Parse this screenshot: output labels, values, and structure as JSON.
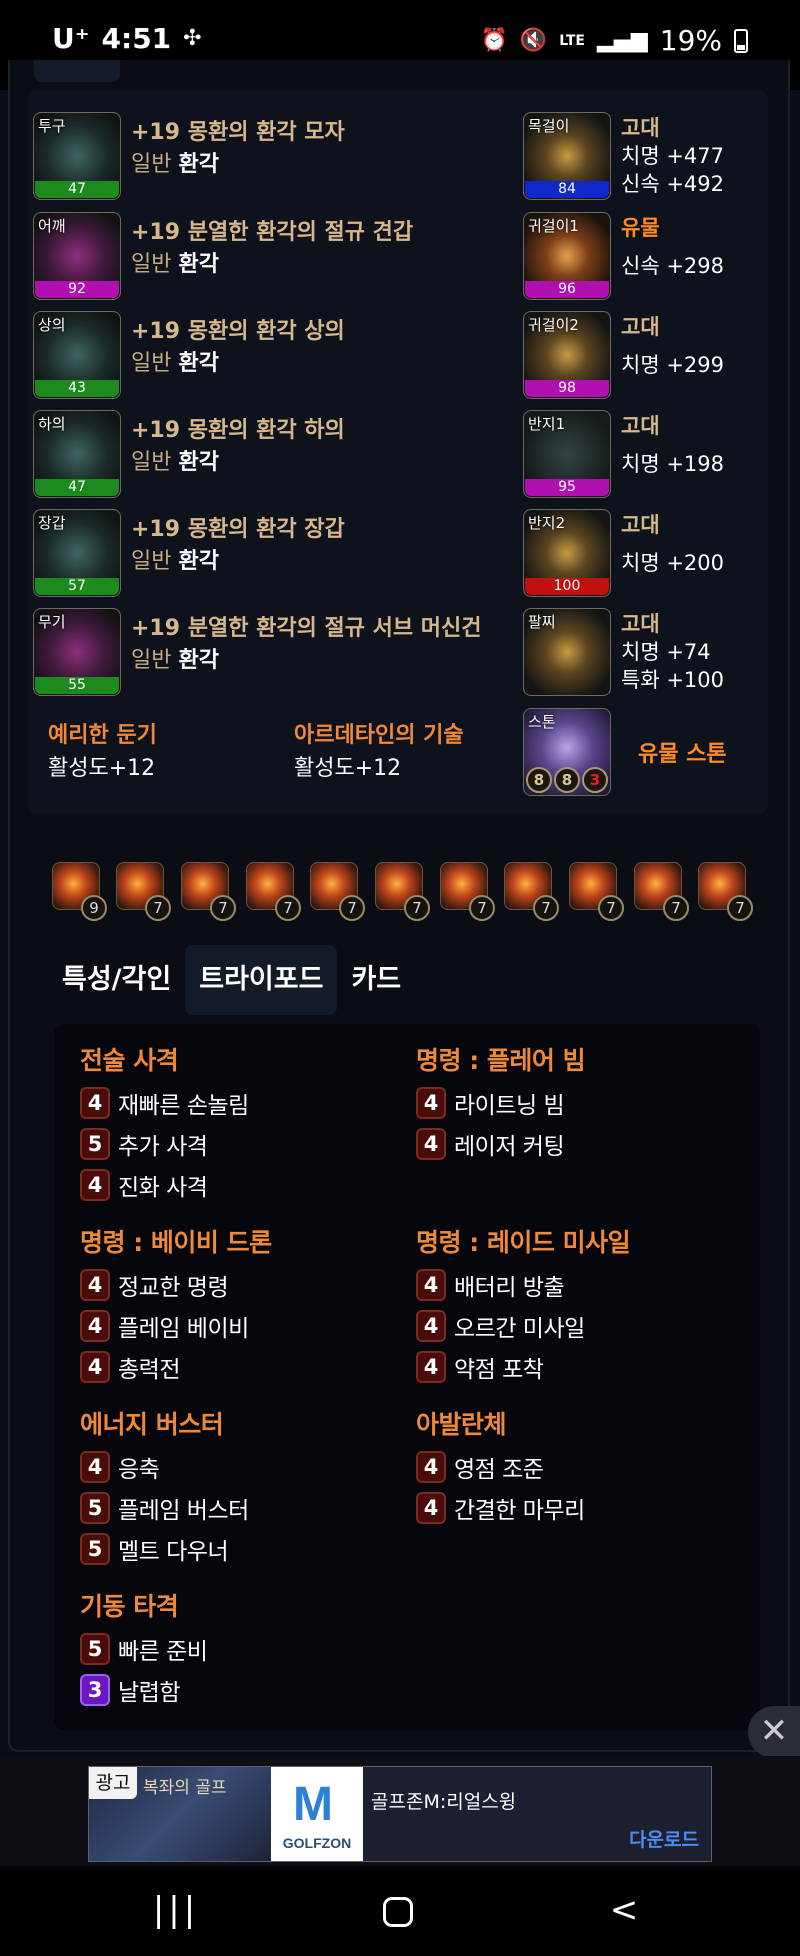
{
  "status_bar": {
    "carrier": "U⁺",
    "time": "4:51",
    "network": "LTE",
    "battery": "19%"
  },
  "equipment": [
    {
      "slot": "투구",
      "quality": 47,
      "quality_color": "#1d8a1d",
      "name": "+19 몽환의 환각 모자",
      "sub_a": "일반",
      "sub_b": "환각",
      "icon": "helmet-icon"
    },
    {
      "slot": "어깨",
      "quality": 92,
      "quality_color": "#b010b0",
      "name": "+19 분열한 환각의 절규 견갑",
      "sub_a": "일반",
      "sub_b": "환각",
      "icon": "shoulder-icon"
    },
    {
      "slot": "상의",
      "quality": 43,
      "quality_color": "#1d8a1d",
      "name": "+19 몽환의 환각 상의",
      "sub_a": "일반",
      "sub_b": "환각",
      "icon": "chest-icon"
    },
    {
      "slot": "하의",
      "quality": 47,
      "quality_color": "#1d8a1d",
      "name": "+19 몽환의 환각 하의",
      "sub_a": "일반",
      "sub_b": "환각",
      "icon": "pants-icon"
    },
    {
      "slot": "장갑",
      "quality": 57,
      "quality_color": "#1d8a1d",
      "name": "+19 몽환의 환각 장갑",
      "sub_a": "일반",
      "sub_b": "환각",
      "icon": "gloves-icon"
    },
    {
      "slot": "무기",
      "quality": 55,
      "quality_color": "#1d8a1d",
      "name": "+19 분열한 환각의 절규 서브 머신건",
      "sub_a": "일반",
      "sub_b": "환각",
      "icon": "weapon-icon"
    }
  ],
  "accessories": [
    {
      "slot": "목걸이",
      "quality": 84,
      "quality_color": "#1028c8",
      "grade": "고대",
      "stats": [
        "치명 +477",
        "신속 +492"
      ],
      "icon": "necklace-icon"
    },
    {
      "slot": "귀걸이1",
      "quality": 96,
      "quality_color": "#b010b0",
      "grade": "유물",
      "stats": [
        "신속 +298"
      ],
      "icon": "earring-icon"
    },
    {
      "slot": "귀걸이2",
      "quality": 98,
      "quality_color": "#b010b0",
      "grade": "고대",
      "stats": [
        "치명 +299"
      ],
      "icon": "earring-icon"
    },
    {
      "slot": "반지1",
      "quality": 95,
      "quality_color": "#b010b0",
      "grade": "고대",
      "stats": [
        "치명 +198"
      ],
      "icon": "ring-icon"
    },
    {
      "slot": "반지2",
      "quality": 100,
      "quality_color": "#c01010",
      "grade": "고대",
      "stats": [
        "치명 +200"
      ],
      "icon": "ring-icon"
    },
    {
      "slot": "팔찌",
      "quality": null,
      "grade": "고대",
      "stats": [
        "치명 +74",
        "특화 +100"
      ],
      "icon": "bracelet-icon"
    }
  ],
  "engravings": [
    {
      "name": "예리한 둔기",
      "value": "활성도+12"
    },
    {
      "name": "아르데타인의 기술",
      "value": "활성도+12"
    }
  ],
  "stone": {
    "slot": "스톤",
    "grade": "유물 스톤",
    "levels": [
      "8",
      "8",
      "3"
    ]
  },
  "gems": [
    "9",
    "7",
    "7",
    "7",
    "7",
    "7",
    "7",
    "7",
    "7",
    "7",
    "7"
  ],
  "tabs": [
    "특성/각인",
    "트라이포드",
    "카드"
  ],
  "active_tab": "트라이포드",
  "tripods": [
    {
      "skill": "전술 사격",
      "items": [
        {
          "lv": "4",
          "name": "재빠른 손놀림"
        },
        {
          "lv": "5",
          "name": "추가 사격"
        },
        {
          "lv": "4",
          "name": "진화 사격"
        }
      ]
    },
    {
      "skill": "명령 : 플레어 빔",
      "items": [
        {
          "lv": "4",
          "name": "라이트닝 빔"
        },
        {
          "lv": "4",
          "name": "레이저 커팅"
        }
      ]
    },
    {
      "skill": "명령 : 베이비 드론",
      "items": [
        {
          "lv": "4",
          "name": "정교한 명령"
        },
        {
          "lv": "4",
          "name": "플레임 베이비"
        },
        {
          "lv": "4",
          "name": "총력전"
        }
      ]
    },
    {
      "skill": "명령 : 레이드 미사일",
      "items": [
        {
          "lv": "4",
          "name": "배터리 방출"
        },
        {
          "lv": "4",
          "name": "오르간 미사일"
        },
        {
          "lv": "4",
          "name": "약점 포착"
        }
      ]
    },
    {
      "skill": "에너지 버스터",
      "items": [
        {
          "lv": "4",
          "name": "응축"
        },
        {
          "lv": "5",
          "name": "플레임 버스터"
        },
        {
          "lv": "5",
          "name": "멜트 다우너"
        }
      ]
    },
    {
      "skill": "아발란체",
      "items": [
        {
          "lv": "4",
          "name": "영점 조준"
        },
        {
          "lv": "4",
          "name": "간결한 마무리"
        }
      ]
    },
    {
      "skill": "기동 타격",
      "items": [
        {
          "lv": "5",
          "name": "빠른 준비"
        },
        {
          "lv": "3",
          "name": "날렵함"
        }
      ]
    }
  ],
  "ad": {
    "tag": "광고",
    "image_title": "복좌의 골프",
    "brand": "GOLFZON",
    "title": "골프존M:리얼스윙",
    "cta": "다운로드"
  },
  "close_symbol": "✕",
  "nav": {
    "recent": "|||",
    "back": "<"
  }
}
